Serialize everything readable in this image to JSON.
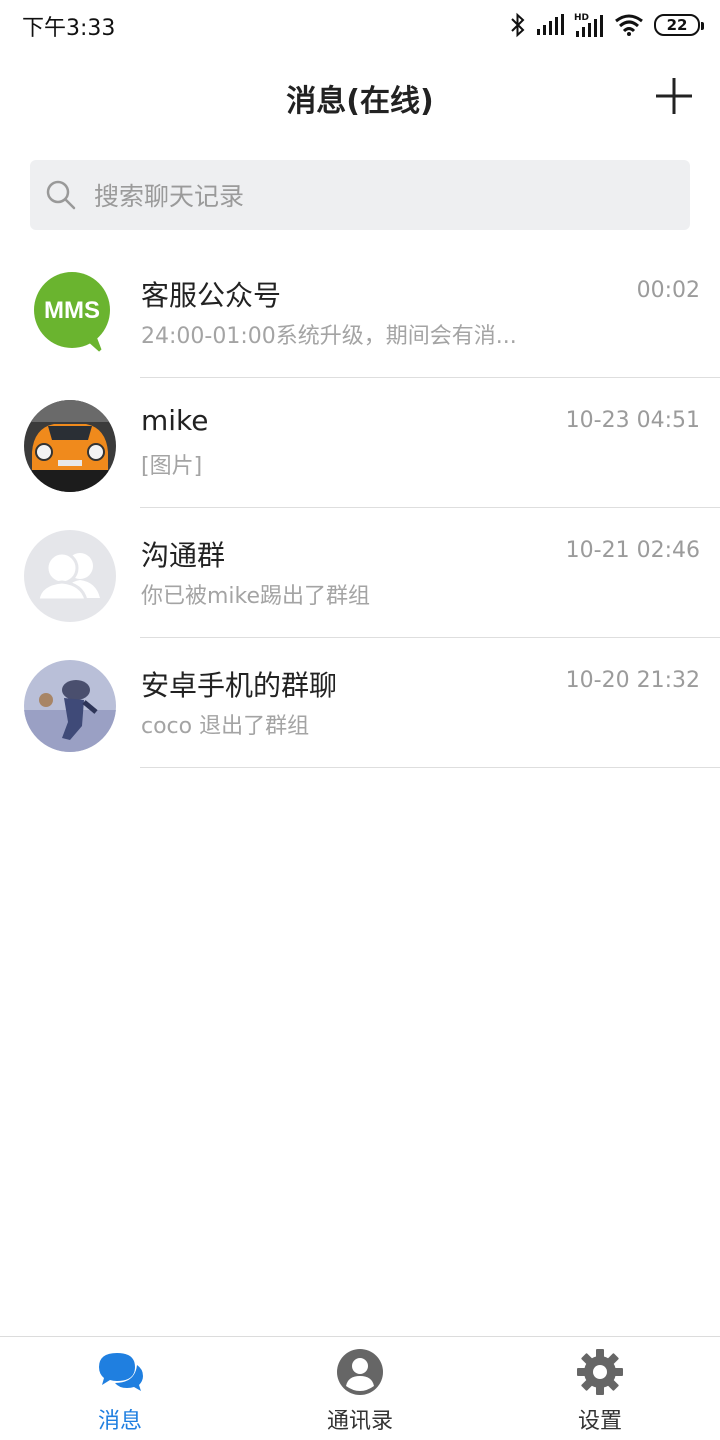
{
  "status_bar": {
    "time": "下午3:33",
    "battery": "22"
  },
  "header": {
    "title": "消息(在线)",
    "add_icon": "plus-icon"
  },
  "search": {
    "placeholder": "搜索聊天记录",
    "icon": "search-icon"
  },
  "conversations": [
    {
      "name": "客服公众号",
      "time": "00:02",
      "preview": "24:00-01:00系统升级，期间会有消...",
      "avatar": "mms-logo"
    },
    {
      "name": "mike",
      "time": "10-23 04:51",
      "preview": "[图片]",
      "avatar": "orange-car-photo"
    },
    {
      "name": "沟通群",
      "time": "10-21 02:46",
      "preview": "你已被mike踢出了群组",
      "avatar": "group-placeholder"
    },
    {
      "name": "安卓手机的群聊",
      "time": "10-20 21:32",
      "preview": "coco 退出了群组",
      "avatar": "anime-photo"
    }
  ],
  "avatar_labels": {
    "mms": "MMS"
  },
  "tabs": [
    {
      "label": "消息",
      "icon": "chat-bubble-icon",
      "active": true
    },
    {
      "label": "通讯录",
      "icon": "contact-icon",
      "active": false
    },
    {
      "label": "设置",
      "icon": "gear-icon",
      "active": false
    }
  ],
  "colors": {
    "accent": "#1f7fe0",
    "mms_green": "#6ab42f",
    "divider": "#dedede"
  }
}
